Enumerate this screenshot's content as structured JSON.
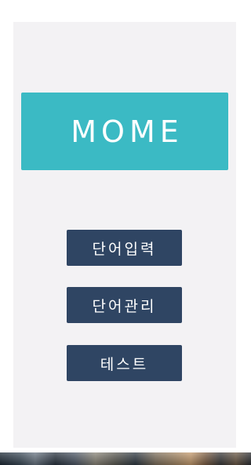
{
  "logo": {
    "text": "MOME",
    "color": "#3bbac4"
  },
  "menu": {
    "button_color": "#2f4563",
    "items": [
      {
        "label": "단어입력"
      },
      {
        "label": "단어관리"
      },
      {
        "label": "테스트"
      }
    ]
  },
  "colors": {
    "panel_background": "#f3f2f4",
    "page_background": "#ffffff"
  }
}
